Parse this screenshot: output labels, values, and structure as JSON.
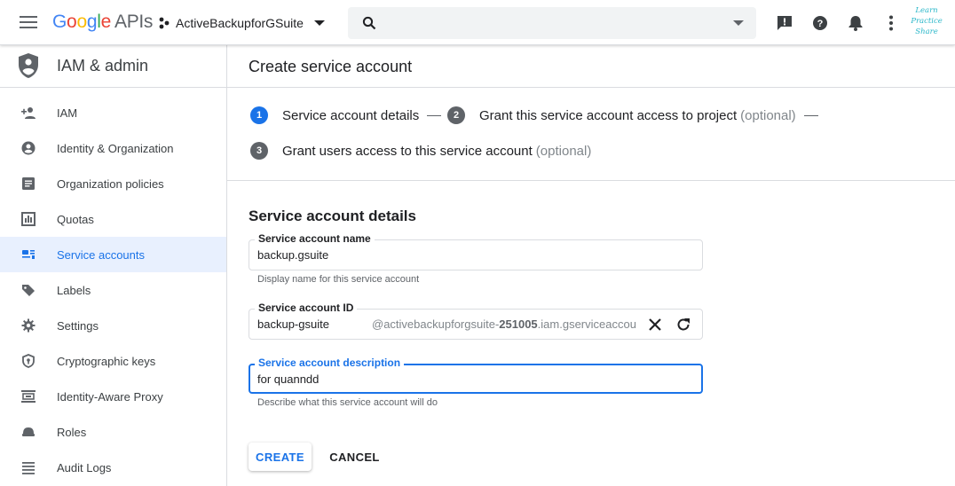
{
  "topbar": {
    "logo": {
      "google": "Google",
      "apis": "APIs"
    },
    "project_name": "ActiveBackupforGSuite",
    "search_placeholder": "",
    "watermark": [
      "Learn",
      "Practice",
      "Share"
    ]
  },
  "sidebar": {
    "title": "IAM & admin",
    "items": [
      {
        "label": "IAM",
        "icon": "person-add-icon",
        "active": false
      },
      {
        "label": "Identity & Organization",
        "icon": "account-circle-icon",
        "active": false
      },
      {
        "label": "Organization policies",
        "icon": "article-icon",
        "active": false
      },
      {
        "label": "Quotas",
        "icon": "quota-icon",
        "active": false
      },
      {
        "label": "Service accounts",
        "icon": "service-account-icon",
        "active": true
      },
      {
        "label": "Labels",
        "icon": "label-icon",
        "active": false
      },
      {
        "label": "Settings",
        "icon": "gear-icon",
        "active": false
      },
      {
        "label": "Cryptographic keys",
        "icon": "shield-key-icon",
        "active": false
      },
      {
        "label": "Identity-Aware Proxy",
        "icon": "proxy-icon",
        "active": false
      },
      {
        "label": "Roles",
        "icon": "roles-icon",
        "active": false
      },
      {
        "label": "Audit Logs",
        "icon": "list-icon",
        "active": false
      }
    ]
  },
  "main": {
    "title": "Create service account",
    "steps": [
      {
        "num": "1",
        "label": "Service account details",
        "optional": ""
      },
      {
        "num": "2",
        "label": "Grant this service account access to project",
        "optional": "(optional)"
      },
      {
        "num": "3",
        "label": "Grant users access to this service account",
        "optional": "(optional)"
      }
    ],
    "section_title": "Service account details",
    "fields": {
      "name": {
        "label": "Service account name",
        "value": "backup.gsuite",
        "hint": "Display name for this service account"
      },
      "id": {
        "label": "Service account ID",
        "value": "backup-gsuite",
        "suffix_pre": "@activebackupforgsuite-",
        "suffix_bold": "251005",
        "suffix_post": ".iam.gserviceaccou"
      },
      "description": {
        "label": "Service account description",
        "value": "for quanndd",
        "hint": "Describe what this service account will do"
      }
    },
    "buttons": {
      "create": "CREATE",
      "cancel": "CANCEL"
    }
  },
  "colors": {
    "accent": "#1a73e8",
    "active_bg": "#e8f0fe",
    "icon_gray": "#5f6368"
  }
}
